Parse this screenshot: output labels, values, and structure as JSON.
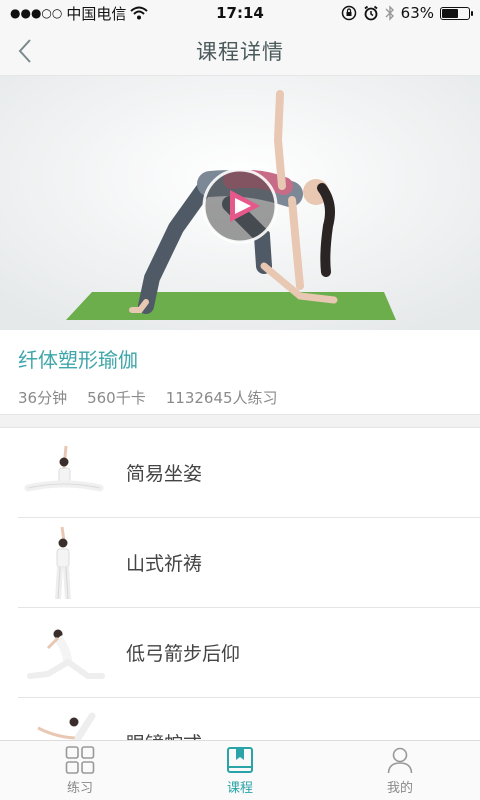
{
  "status_bar": {
    "carrier": "中国电信",
    "time": "17:14",
    "battery_percent": "63%",
    "battery_level": 0.63
  },
  "nav": {
    "title": "课程详情"
  },
  "course": {
    "title": "纤体塑形瑜伽",
    "duration": "36分钟",
    "calories": "560千卡",
    "participants": "1132645人练习"
  },
  "poses": [
    {
      "label": "简易坐姿"
    },
    {
      "label": "山式祈祷"
    },
    {
      "label": "低弓箭步后仰"
    },
    {
      "label": "眼镜蛇式"
    }
  ],
  "tabs": [
    {
      "label": "练习",
      "icon": "grid-icon"
    },
    {
      "label": "课程",
      "icon": "bookmark-book-icon"
    },
    {
      "label": "我的",
      "icon": "person-icon"
    }
  ],
  "colors": {
    "accent": "#2aa4a8",
    "title_teal": "#3fa6a9",
    "mat_green": "#6cae4c"
  }
}
